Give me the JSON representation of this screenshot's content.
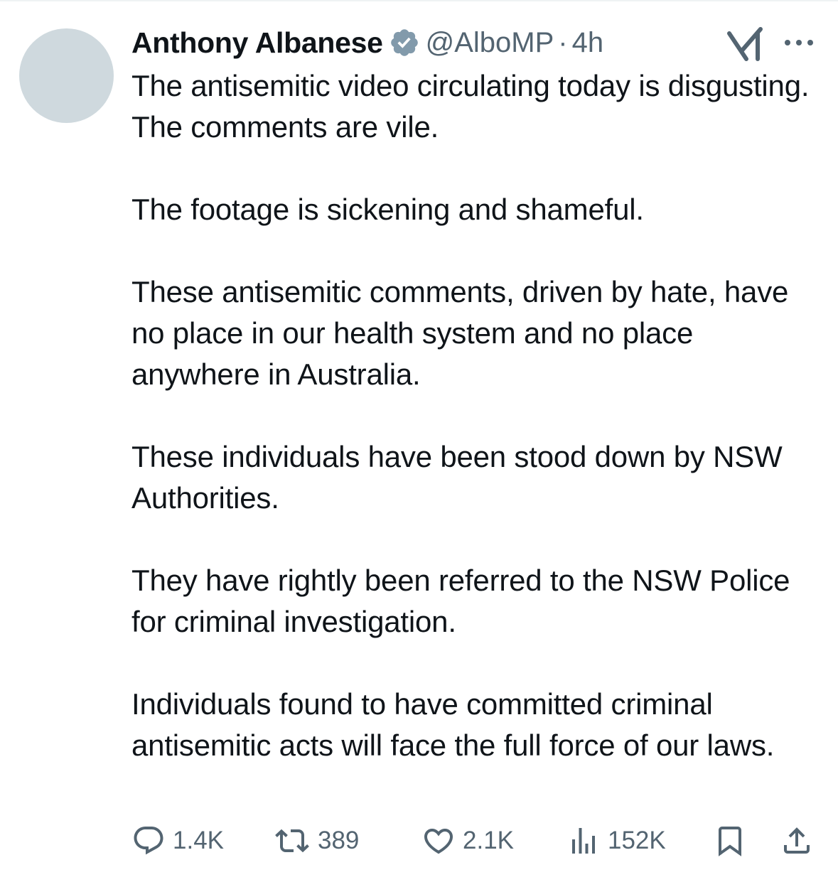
{
  "tweet": {
    "author": {
      "display_name": "Anthony Albanese",
      "handle": "@AlboMP",
      "verified": true
    },
    "separator": "·",
    "time": "4h",
    "paragraphs": [
      "The antisemitic video circulating today is disgusting. The comments are vile.",
      "The footage is sickening and shameful.",
      "These antisemitic comments, driven by hate, have no place in our health system and no place anywhere in Australia.",
      "These individuals have been stood down by NSW Authorities.",
      "They have rightly been referred to the NSW Police for criminal investigation.",
      "Individuals found to have committed criminal antisemitic acts will face the full force of our laws."
    ],
    "actions": {
      "replies": "1.4K",
      "reposts": "389",
      "likes": "2.1K",
      "views": "152K"
    }
  },
  "icons": {
    "verified": "verified-badge-icon",
    "grok": "grok-icon",
    "more": "more-icon",
    "reply": "reply-icon",
    "repost": "repost-icon",
    "like": "like-icon",
    "views": "views-icon",
    "bookmark": "bookmark-icon",
    "share": "share-icon"
  },
  "colors": {
    "text": "#0f1419",
    "secondary": "#536471",
    "verified_badge": "#829aab",
    "avatar_placeholder": "#cfd9de",
    "divider": "#eff3f4"
  }
}
